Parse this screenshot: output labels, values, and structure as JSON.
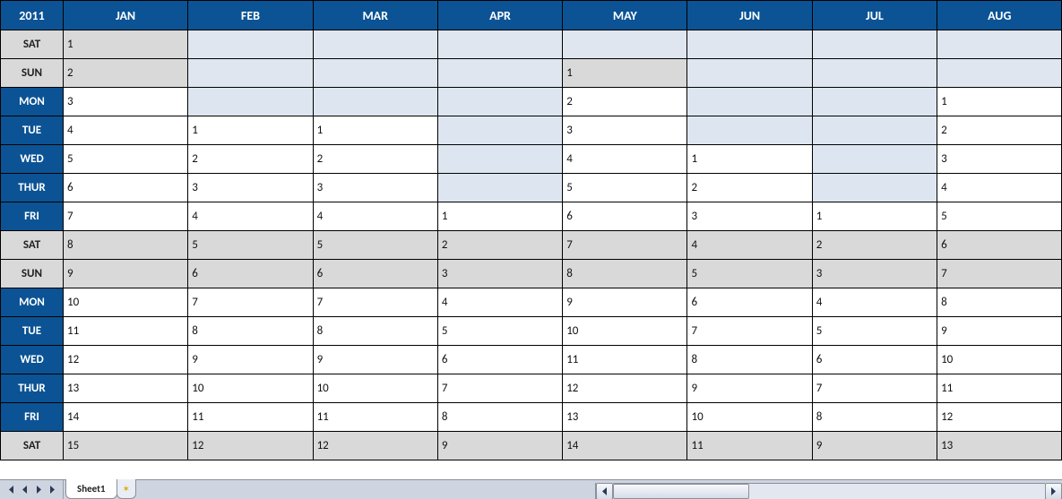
{
  "header": {
    "year": "2011",
    "months": [
      "JAN",
      "FEB",
      "MAR",
      "APR",
      "MAY",
      "JUN",
      "JUL",
      "AUG"
    ]
  },
  "rows": [
    {
      "day": "SAT",
      "weekend": true,
      "cells": [
        "1",
        "",
        "",
        "",
        "",
        "",
        "",
        ""
      ]
    },
    {
      "day": "SUN",
      "weekend": true,
      "cells": [
        "2",
        "",
        "",
        "",
        "1",
        "",
        "",
        ""
      ]
    },
    {
      "day": "MON",
      "weekend": false,
      "cells": [
        "3",
        "",
        "",
        "",
        "2",
        "",
        "",
        "1"
      ]
    },
    {
      "day": "TUE",
      "weekend": false,
      "cells": [
        "4",
        "1",
        "1",
        "",
        "3",
        "",
        "",
        "2"
      ]
    },
    {
      "day": "WED",
      "weekend": false,
      "cells": [
        "5",
        "2",
        "2",
        "",
        "4",
        "1",
        "",
        "3"
      ]
    },
    {
      "day": "THUR",
      "weekend": false,
      "cells": [
        "6",
        "3",
        "3",
        "",
        "5",
        "2",
        "",
        "4"
      ]
    },
    {
      "day": "FRI",
      "weekend": false,
      "cells": [
        "7",
        "4",
        "4",
        "1",
        "6",
        "3",
        "1",
        "5"
      ]
    },
    {
      "day": "SAT",
      "weekend": true,
      "cells": [
        "8",
        "5",
        "5",
        "2",
        "7",
        "4",
        "2",
        "6"
      ]
    },
    {
      "day": "SUN",
      "weekend": true,
      "cells": [
        "9",
        "6",
        "6",
        "3",
        "8",
        "5",
        "3",
        "7"
      ]
    },
    {
      "day": "MON",
      "weekend": false,
      "cells": [
        "10",
        "7",
        "7",
        "4",
        "9",
        "6",
        "4",
        "8"
      ]
    },
    {
      "day": "TUE",
      "weekend": false,
      "cells": [
        "11",
        "8",
        "8",
        "5",
        "10",
        "7",
        "5",
        "9"
      ]
    },
    {
      "day": "WED",
      "weekend": false,
      "cells": [
        "12",
        "9",
        "9",
        "6",
        "11",
        "8",
        "6",
        "10"
      ]
    },
    {
      "day": "THUR",
      "weekend": false,
      "cells": [
        "13",
        "10",
        "10",
        "7",
        "12",
        "9",
        "7",
        "11"
      ]
    },
    {
      "day": "FRI",
      "weekend": false,
      "cells": [
        "14",
        "11",
        "11",
        "8",
        "13",
        "10",
        "8",
        "12"
      ]
    },
    {
      "day": "SAT",
      "weekend": true,
      "cells": [
        "15",
        "12",
        "12",
        "9",
        "14",
        "11",
        "9",
        "13"
      ]
    }
  ],
  "tabs": {
    "active": "Sheet1"
  }
}
